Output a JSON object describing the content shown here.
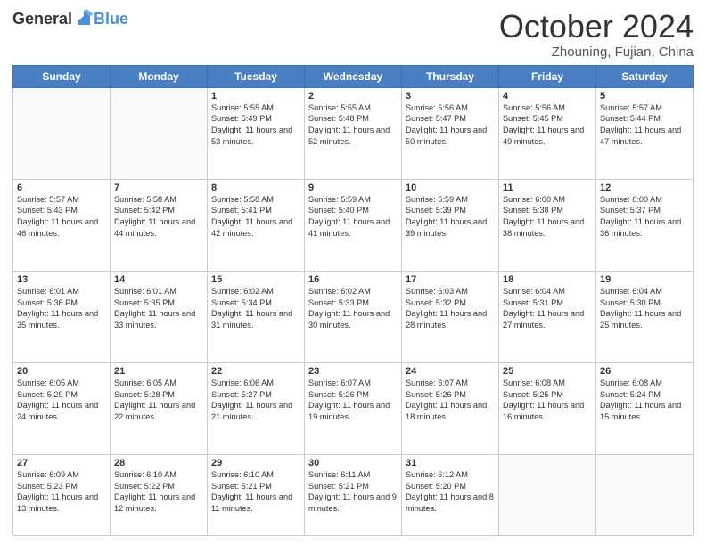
{
  "header": {
    "logo_general": "General",
    "logo_blue": "Blue",
    "month_title": "October 2024",
    "location": "Zhouning, Fujian, China"
  },
  "days_of_week": [
    "Sunday",
    "Monday",
    "Tuesday",
    "Wednesday",
    "Thursday",
    "Friday",
    "Saturday"
  ],
  "weeks": [
    [
      {
        "day": "",
        "info": ""
      },
      {
        "day": "",
        "info": ""
      },
      {
        "day": "1",
        "info": "Sunrise: 5:55 AM\nSunset: 5:49 PM\nDaylight: 11 hours and 53 minutes."
      },
      {
        "day": "2",
        "info": "Sunrise: 5:55 AM\nSunset: 5:48 PM\nDaylight: 11 hours and 52 minutes."
      },
      {
        "day": "3",
        "info": "Sunrise: 5:56 AM\nSunset: 5:47 PM\nDaylight: 11 hours and 50 minutes."
      },
      {
        "day": "4",
        "info": "Sunrise: 5:56 AM\nSunset: 5:45 PM\nDaylight: 11 hours and 49 minutes."
      },
      {
        "day": "5",
        "info": "Sunrise: 5:57 AM\nSunset: 5:44 PM\nDaylight: 11 hours and 47 minutes."
      }
    ],
    [
      {
        "day": "6",
        "info": "Sunrise: 5:57 AM\nSunset: 5:43 PM\nDaylight: 11 hours and 46 minutes."
      },
      {
        "day": "7",
        "info": "Sunrise: 5:58 AM\nSunset: 5:42 PM\nDaylight: 11 hours and 44 minutes."
      },
      {
        "day": "8",
        "info": "Sunrise: 5:58 AM\nSunset: 5:41 PM\nDaylight: 11 hours and 42 minutes."
      },
      {
        "day": "9",
        "info": "Sunrise: 5:59 AM\nSunset: 5:40 PM\nDaylight: 11 hours and 41 minutes."
      },
      {
        "day": "10",
        "info": "Sunrise: 5:59 AM\nSunset: 5:39 PM\nDaylight: 11 hours and 39 minutes."
      },
      {
        "day": "11",
        "info": "Sunrise: 6:00 AM\nSunset: 5:38 PM\nDaylight: 11 hours and 38 minutes."
      },
      {
        "day": "12",
        "info": "Sunrise: 6:00 AM\nSunset: 5:37 PM\nDaylight: 11 hours and 36 minutes."
      }
    ],
    [
      {
        "day": "13",
        "info": "Sunrise: 6:01 AM\nSunset: 5:36 PM\nDaylight: 11 hours and 35 minutes."
      },
      {
        "day": "14",
        "info": "Sunrise: 6:01 AM\nSunset: 5:35 PM\nDaylight: 11 hours and 33 minutes."
      },
      {
        "day": "15",
        "info": "Sunrise: 6:02 AM\nSunset: 5:34 PM\nDaylight: 11 hours and 31 minutes."
      },
      {
        "day": "16",
        "info": "Sunrise: 6:02 AM\nSunset: 5:33 PM\nDaylight: 11 hours and 30 minutes."
      },
      {
        "day": "17",
        "info": "Sunrise: 6:03 AM\nSunset: 5:32 PM\nDaylight: 11 hours and 28 minutes."
      },
      {
        "day": "18",
        "info": "Sunrise: 6:04 AM\nSunset: 5:31 PM\nDaylight: 11 hours and 27 minutes."
      },
      {
        "day": "19",
        "info": "Sunrise: 6:04 AM\nSunset: 5:30 PM\nDaylight: 11 hours and 25 minutes."
      }
    ],
    [
      {
        "day": "20",
        "info": "Sunrise: 6:05 AM\nSunset: 5:29 PM\nDaylight: 11 hours and 24 minutes."
      },
      {
        "day": "21",
        "info": "Sunrise: 6:05 AM\nSunset: 5:28 PM\nDaylight: 11 hours and 22 minutes."
      },
      {
        "day": "22",
        "info": "Sunrise: 6:06 AM\nSunset: 5:27 PM\nDaylight: 11 hours and 21 minutes."
      },
      {
        "day": "23",
        "info": "Sunrise: 6:07 AM\nSunset: 5:26 PM\nDaylight: 11 hours and 19 minutes."
      },
      {
        "day": "24",
        "info": "Sunrise: 6:07 AM\nSunset: 5:26 PM\nDaylight: 11 hours and 18 minutes."
      },
      {
        "day": "25",
        "info": "Sunrise: 6:08 AM\nSunset: 5:25 PM\nDaylight: 11 hours and 16 minutes."
      },
      {
        "day": "26",
        "info": "Sunrise: 6:08 AM\nSunset: 5:24 PM\nDaylight: 11 hours and 15 minutes."
      }
    ],
    [
      {
        "day": "27",
        "info": "Sunrise: 6:09 AM\nSunset: 5:23 PM\nDaylight: 11 hours and 13 minutes."
      },
      {
        "day": "28",
        "info": "Sunrise: 6:10 AM\nSunset: 5:22 PM\nDaylight: 11 hours and 12 minutes."
      },
      {
        "day": "29",
        "info": "Sunrise: 6:10 AM\nSunset: 5:21 PM\nDaylight: 11 hours and 11 minutes."
      },
      {
        "day": "30",
        "info": "Sunrise: 6:11 AM\nSunset: 5:21 PM\nDaylight: 11 hours and 9 minutes."
      },
      {
        "day": "31",
        "info": "Sunrise: 6:12 AM\nSunset: 5:20 PM\nDaylight: 11 hours and 8 minutes."
      },
      {
        "day": "",
        "info": ""
      },
      {
        "day": "",
        "info": ""
      }
    ]
  ]
}
